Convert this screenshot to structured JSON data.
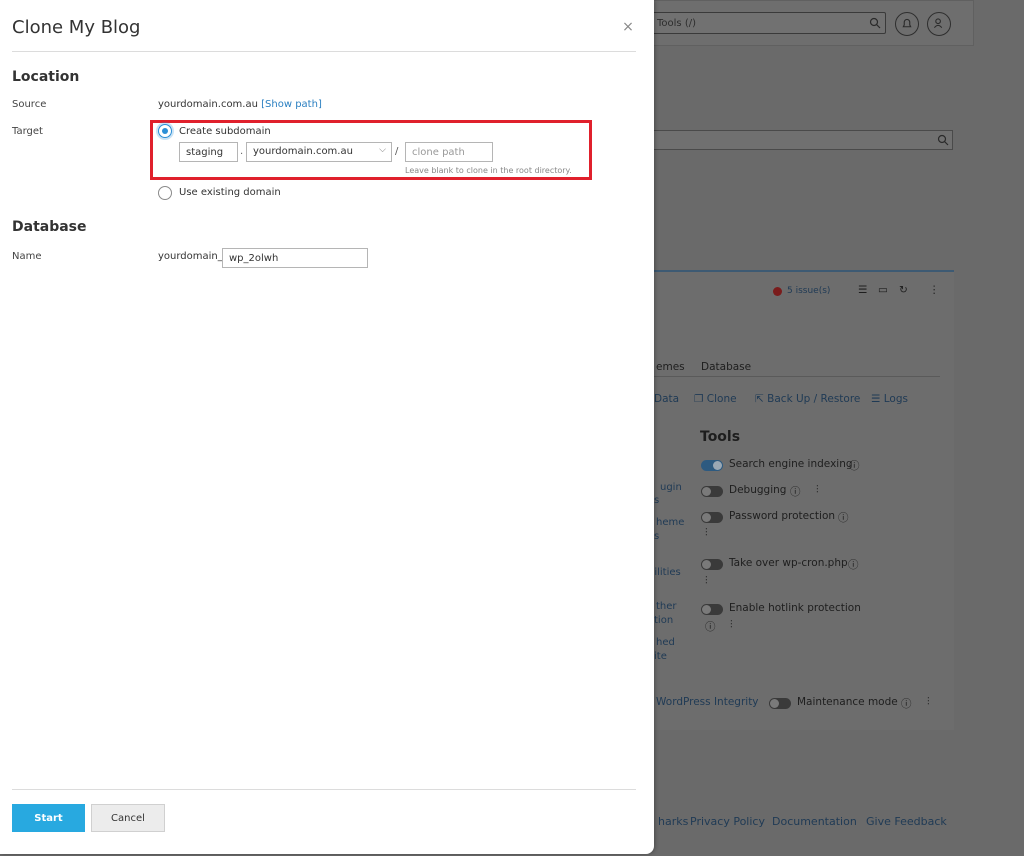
{
  "background": {
    "search_placeholder": "Tools (/)",
    "issues": "5 issue(s)",
    "tabs": [
      "emes",
      "Database"
    ],
    "actions": [
      "Data",
      "Clone",
      "Back Up / Restore",
      "Logs"
    ],
    "left_fragments": [
      "ugin",
      "s",
      "heme",
      "s",
      "bilities",
      "ther",
      "tion",
      "hed",
      "ite"
    ],
    "tools_title": "Tools",
    "tools": [
      {
        "label": "Search engine indexing",
        "on": true
      },
      {
        "label": "Debugging",
        "on": false
      },
      {
        "label": "Password protection",
        "on": false
      },
      {
        "label": "Take over wp-cron.php",
        "on": false
      },
      {
        "label": "Enable hotlink protection",
        "on": false
      }
    ],
    "integrity": "WordPress Integrity",
    "maintenance": "Maintenance mode",
    "footer_links": [
      "harks",
      "Privacy Policy",
      "Documentation",
      "Give Feedback"
    ]
  },
  "modal": {
    "title": "Clone My Blog",
    "close_symbol": "×",
    "location": {
      "heading": "Location",
      "source_label": "Source",
      "source_value": "yourdomain.com.au",
      "show_path": "[Show path]",
      "target_label": "Target",
      "option_subdomain": "Create subdomain",
      "subdomain_value": "staging",
      "dot_separator": ".",
      "domain_selected": "yourdomain.com.au",
      "slash_separator": "/",
      "clone_path_placeholder": "clone path",
      "clone_path_hint": "Leave blank to clone in the root directory.",
      "option_existing": "Use existing domain"
    },
    "database": {
      "heading": "Database",
      "name_label": "Name",
      "name_prefix": "yourdomain_",
      "name_value": "wp_2olwh"
    },
    "buttons": {
      "start": "Start",
      "cancel": "Cancel"
    }
  }
}
